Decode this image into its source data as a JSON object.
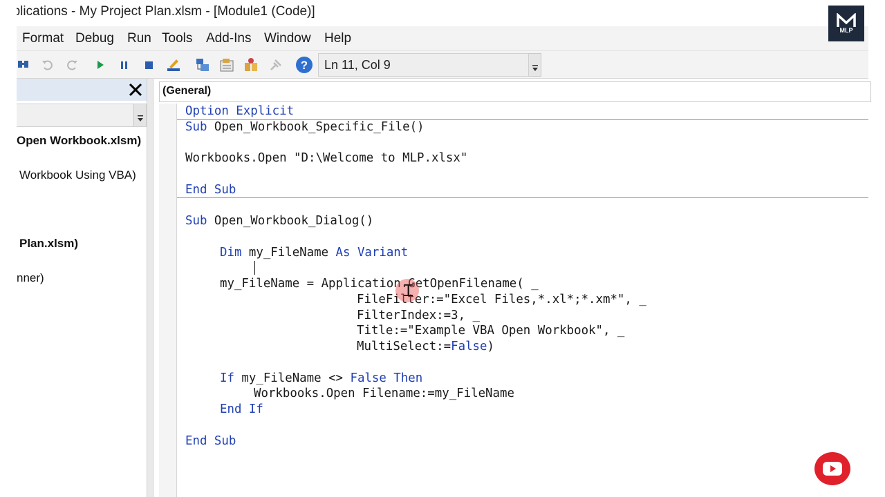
{
  "window": {
    "title": "pplications - My Project Plan.xlsm - [Module1 (Code)]"
  },
  "menu": {
    "items": [
      {
        "label": "Format"
      },
      {
        "label": "Debug"
      },
      {
        "label": "Run"
      },
      {
        "label": "Tools"
      },
      {
        "label": "Add-Ins"
      },
      {
        "label": "Window"
      },
      {
        "label": "Help"
      }
    ]
  },
  "toolbar": {
    "position_text": "Ln 11, Col 9",
    "icons": [
      "find-icon",
      "undo-icon",
      "redo-icon",
      "run-icon",
      "break-icon",
      "reset-icon",
      "design-mode-icon",
      "project-explorer-icon",
      "properties-icon",
      "object-browser-icon",
      "toolbox-icon",
      "help-icon"
    ]
  },
  "project_panel": {
    "items": [
      {
        "label": "Open Workbook.xlsm)",
        "bold": true
      },
      {
        "label": "Workbook Using VBA)",
        "bold": false
      },
      {
        "label": "Plan.xlsm)",
        "bold": true
      },
      {
        "label": "nner)",
        "bold": false
      }
    ]
  },
  "code": {
    "object_combo": "(General)",
    "lines": [
      {
        "kw1": "Option Explicit"
      },
      {
        "kw1": "Sub",
        "rest": " Open_Workbook_Specific_File()"
      },
      {
        "rest": "Workbooks.Open \"D:\\Welcome to MLP.xlsx\""
      },
      {
        "kw1": "End Sub"
      },
      {
        "kw1": "Sub",
        "rest": " Open_Workbook_Dialog()"
      },
      {
        "kw1": "Dim",
        "mid": " my_FileName ",
        "kw2": "As Variant"
      },
      {
        "rest": "my_FileName = Application.GetOpenFilename( _"
      },
      {
        "rest": "FileFilter:=\"Excel Files,*.xl*;*.xm*\", _"
      },
      {
        "rest": "FilterIndex:=3, _"
      },
      {
        "rest": "Title:=\"Example VBA Open Workbook\", _"
      },
      {
        "pre": "MultiSelect:=",
        "kw2": "False",
        "post": ")"
      },
      {
        "kw1": "If",
        "mid": " my_FileName <> ",
        "kw2": "False Then"
      },
      {
        "rest": "Workbooks.Open Filename:=my_FileName"
      },
      {
        "kw1": "End If"
      },
      {
        "kw1": "End Sub"
      }
    ]
  },
  "branding": {
    "logo_text": "MLP",
    "accent": "#1e2a3c",
    "keyword_color": "#1f3fb3"
  }
}
